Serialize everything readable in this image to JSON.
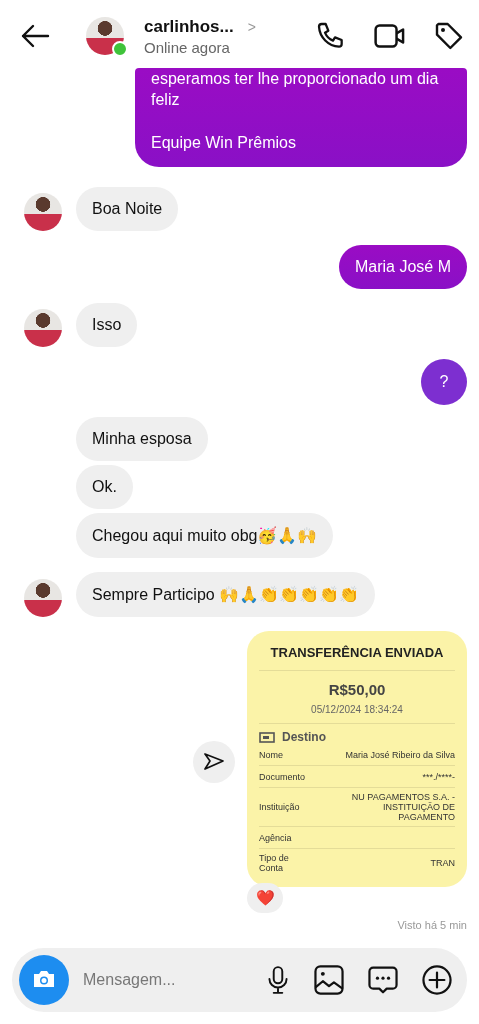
{
  "header": {
    "contact_name": "carlinhos...",
    "chevron": ">",
    "status": "Online agora",
    "online": true
  },
  "messages": [
    {
      "kind": "outgoing",
      "paragraphs": [
        "esperamos ter lhe proporcionado um dia feliz",
        "Equipe Win Prêmios"
      ],
      "accent": true
    },
    {
      "kind": "incoming",
      "text": "Boa Noite",
      "avatar": true
    },
    {
      "kind": "outgoing",
      "text": "Maria José M",
      "accent": true
    },
    {
      "kind": "incoming",
      "text": "Isso",
      "avatar": true
    },
    {
      "kind": "round",
      "text": "?"
    },
    {
      "kind": "incoming",
      "text": "Minha esposa",
      "avatar": false
    },
    {
      "kind": "incoming",
      "text": "Ok.",
      "avatar": false
    },
    {
      "kind": "incoming",
      "text": "Chegou aqui muito obg🥳🙏🙌",
      "avatar": false
    },
    {
      "kind": "incoming",
      "text": "Sempre Participo 🙌🙏👏👏👏👏👏",
      "avatar": true
    },
    {
      "kind": "receipt",
      "title": "TRANSFERÊNCIA ENVIADA",
      "amount": "R$50,00",
      "datetime": "05/12/2024 18:34:24",
      "section": "Destino",
      "rows": [
        {
          "label": "Nome",
          "value": "Maria José Ribeiro da Silva"
        },
        {
          "label": "Documento",
          "value": "***./****-"
        },
        {
          "label": "Instituição",
          "value": "NU PAGAMENTOS S.A. - INSTITUIÇÃO DE PAGAMENTO"
        },
        {
          "label": "Agência"
        },
        {
          "label": "Tipo de Conta",
          "value": "TRAN"
        }
      ],
      "reaction": "❤️"
    }
  ],
  "seen": "Visto há 5 min",
  "composer": {
    "placeholder": "Mensagem..."
  }
}
